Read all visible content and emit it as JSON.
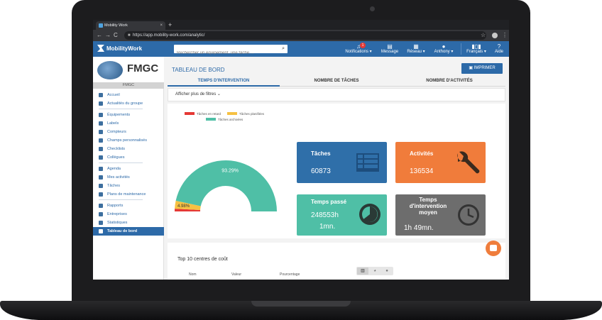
{
  "browser": {
    "tab_title": "Mobility Work",
    "new_tab": "+",
    "tab_close": "×",
    "url": "https://app.mobility-work.com/analytic/",
    "nav": {
      "back": "←",
      "forward": "→",
      "reload": "C"
    }
  },
  "header": {
    "logo": "MobilityWork",
    "search_placeholder": "Rechercher un équipement, une tâche ...",
    "notifications_label": "Notifications ▾",
    "notifications_count": "1",
    "message_label": "Message",
    "reseau_label": "Réseau ▾",
    "user_label": "Anthony ▾",
    "language_label": "Français ▾",
    "help_label": "Aide"
  },
  "sidebar": {
    "brand": "FMGC",
    "brand_sub": "FMGC",
    "items": [
      {
        "label": "Accueil"
      },
      {
        "label": "Actualités du groupe"
      },
      {
        "label": "Équipements"
      },
      {
        "label": "Labels"
      },
      {
        "label": "Compteurs"
      },
      {
        "label": "Champs personnalisés"
      },
      {
        "label": "Checklists"
      },
      {
        "label": "Collègues"
      },
      {
        "label": "Agenda"
      },
      {
        "label": "Mes activités"
      },
      {
        "label": "Tâches"
      },
      {
        "label": "Plans de maintenance"
      },
      {
        "label": "Rapports"
      },
      {
        "label": "Entreprises"
      },
      {
        "label": "Statistiques"
      },
      {
        "label": "Tableau de bord"
      }
    ]
  },
  "main": {
    "title": "TABLEAU DE BORD",
    "print_label": "IMPRIMER",
    "tabs": [
      {
        "label": "TEMPS D'INTERVENTION"
      },
      {
        "label": "NOMBRE DE TÂCHES"
      },
      {
        "label": "NOMBRE D'ACTIVITÉS"
      }
    ],
    "filters_label": "Afficher plus de filtres",
    "cards": [
      {
        "title": "Tâches",
        "value": "60873",
        "color": "#2f6fa9"
      },
      {
        "title": "Activités",
        "value": "136534",
        "color": "#f07c3b"
      },
      {
        "title": "Temps passé",
        "value": "248553h",
        "value2": "1mn.",
        "color": "#4fbfa6"
      },
      {
        "title": "Temps",
        "title2": "d'intervention",
        "title3": "moyen",
        "value": "1h 49mn.",
        "color": "#6d6d6d"
      }
    ],
    "top10_title": "Top 10 centres de coût",
    "table_columns": [
      "Nom",
      "Valeur",
      "Pourcentage"
    ]
  },
  "chart_data": {
    "type": "pie",
    "series": [
      {
        "name": "Tâches en retard",
        "color": "#e53935"
      },
      {
        "name": "Tâches planifiées",
        "value": 4.98,
        "label": "4.98%",
        "color": "#f6c142"
      },
      {
        "name": "Tâches archivées",
        "value": 93.29,
        "label": "93.29%",
        "color": "#4fbfa6"
      }
    ]
  }
}
